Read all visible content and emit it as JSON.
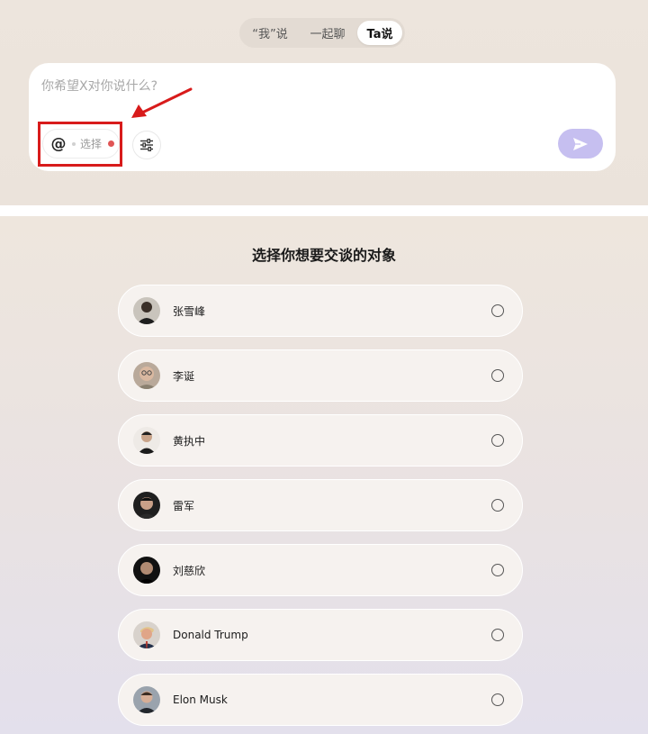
{
  "mode_tabs": [
    {
      "label": "“我”说",
      "active": false
    },
    {
      "label": "一起聊",
      "active": false
    },
    {
      "label": "Ta说",
      "active": true
    }
  ],
  "input": {
    "placeholder": "你希望X对你说什么?",
    "value": ""
  },
  "mention": {
    "symbol": "@",
    "label": "选择",
    "icon": "at-icon"
  },
  "settings": {
    "icon": "sliders-icon"
  },
  "send": {
    "icon": "paper-plane-icon",
    "color": "#c6bff0"
  },
  "annotation": {
    "box_color": "#d81b1b",
    "arrow_color": "#d81b1b"
  },
  "selection": {
    "title": "选择你想要交谈的对象",
    "people": [
      {
        "name": "张雪峰",
        "avatar": "person-avatar-icon",
        "selected": false
      },
      {
        "name": "李诞",
        "avatar": "person-avatar-icon",
        "selected": false
      },
      {
        "name": "黄执中",
        "avatar": "person-avatar-icon",
        "selected": false
      },
      {
        "name": "雷军",
        "avatar": "person-avatar-icon",
        "selected": false
      },
      {
        "name": "刘慈欣",
        "avatar": "person-avatar-icon",
        "selected": false
      },
      {
        "name": "Donald Trump",
        "avatar": "person-avatar-icon",
        "selected": false
      },
      {
        "name": "Elon Musk",
        "avatar": "person-avatar-icon",
        "selected": false
      }
    ]
  }
}
